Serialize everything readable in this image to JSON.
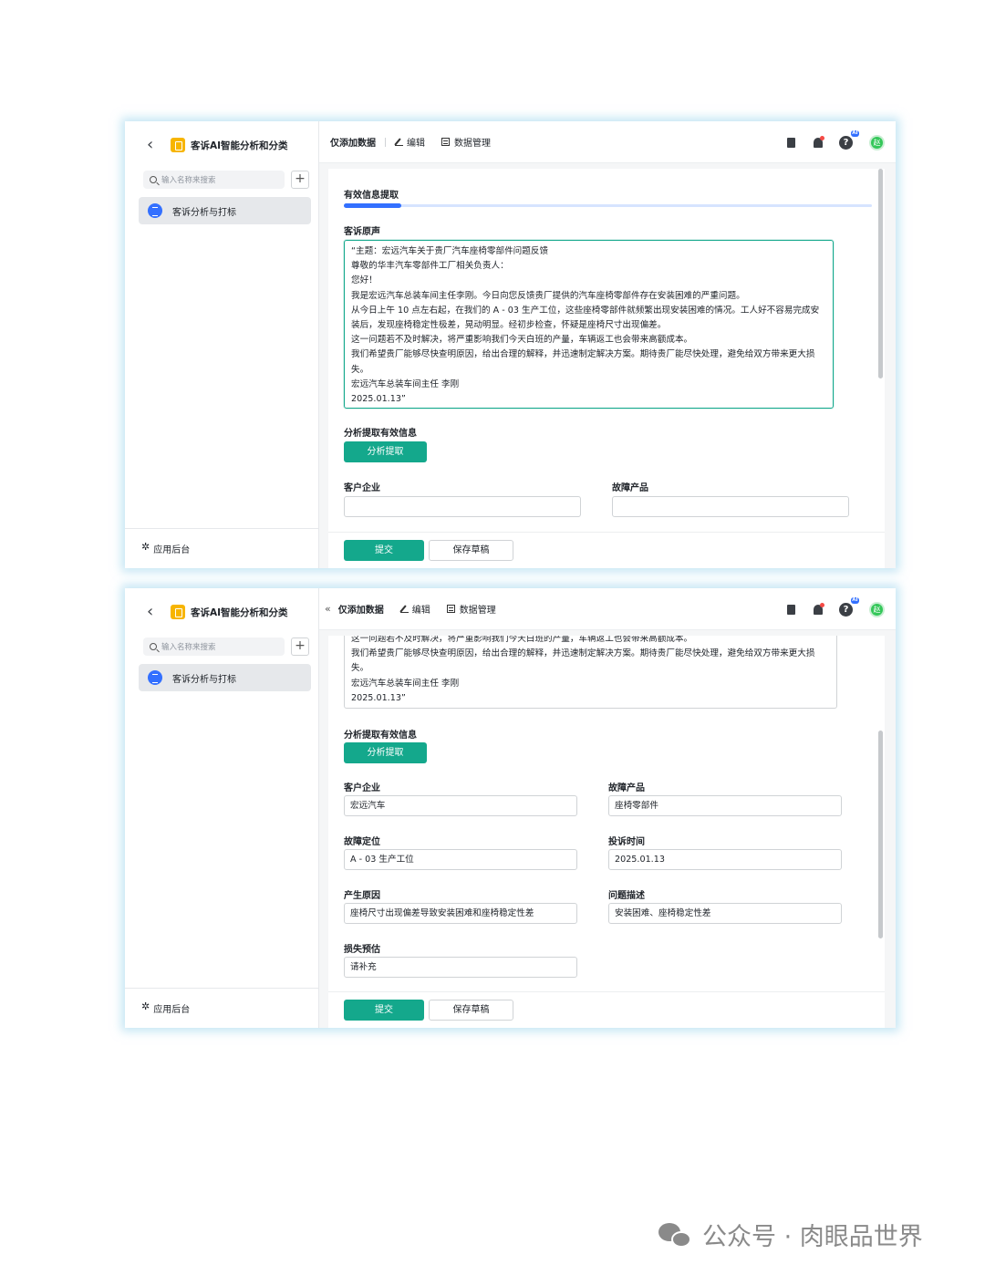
{
  "app": {
    "title": "客诉AI智能分析和分类",
    "search_placeholder": "输入名称来搜索",
    "sidebar_item": "客诉分析与打标",
    "footer": "应用后台"
  },
  "toolbar": {
    "view": "仅添加数据",
    "edit": "编辑",
    "data_manage": "数据管理",
    "avatar": "赵",
    "ai_badge": "AI"
  },
  "form": {
    "tab": "有效信息提取",
    "complaint_label": "客诉原声",
    "complaint_text": "“主题：宏远汽车关于贵厂汽车座椅零部件问题反馈\n尊敬的华丰汽车零部件工厂相关负责人：\n您好！\n我是宏远汽车总装车间主任李刚。今日向您反馈贵厂提供的汽车座椅零部件存在安装困难的严重问题。\n从今日上午 10 点左右起，在我们的 A - 03 生产工位，这些座椅零部件就频繁出现安装困难的情况。工人好不容易完成安装后，发现座椅稳定性极差，晃动明显。经初步检查，怀疑是座椅尺寸出现偏差。\n这一问题若不及时解决，将严重影响我们今天白班的产量，车辆返工也会带来高额成本。\n我们希望贵厂能够尽快查明原因，给出合理的解释，并迅速制定解决方案。期待贵厂能尽快处理，避免给双方带来更大损失。\n宏远汽车总装车间主任 李刚\n2025.01.13”",
    "complaint_text_partial": "这一问题若不及时解决，将严重影响我们今天白班的产量，车辆返工也会带来高额成本。\n我们希望贵厂能够尽快查明原因，给出合理的解释，并迅速制定解决方案。期待贵厂能尽快处理，避免给双方带来更大损失。\n宏远汽车总装车间主任 李刚\n2025.01.13”",
    "analyze_label": "分析提取有效信息",
    "analyze_button": "分析提取",
    "fields": {
      "customer": {
        "label": "客户企业",
        "value": "宏远汽车"
      },
      "product": {
        "label": "故障产品",
        "value": "座椅零部件"
      },
      "location": {
        "label": "故障定位",
        "value": "A - 03 生产工位"
      },
      "time": {
        "label": "投诉时间",
        "value": "2025.01.13"
      },
      "cause": {
        "label": "产生原因",
        "value": "座椅尺寸出现偏差导致安装困难和座椅稳定性差"
      },
      "description": {
        "label": "问题描述",
        "value": "安装困难、座椅稳定性差"
      },
      "loss": {
        "label": "损失预估",
        "value": "请补充"
      }
    },
    "submit": "提交",
    "save_draft": "保存草稿"
  },
  "watermark": "公众号 · 肉眼品世界"
}
